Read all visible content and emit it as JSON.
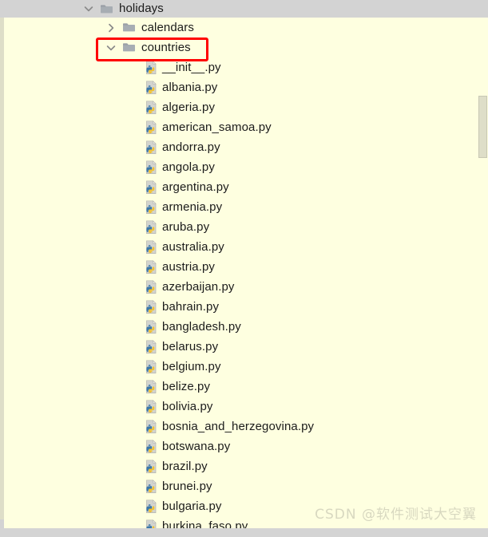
{
  "window": {
    "background_color": "#FEFFE0",
    "header_background_color": "#D3D3D3"
  },
  "tree": {
    "root": {
      "label": "holidays",
      "icon": "folder-icon",
      "chevron": "chevron-down-icon",
      "expanded": true,
      "selected": true,
      "indent": 1
    },
    "folders": [
      {
        "label": "calendars",
        "icon": "folder-icon",
        "chevron": "chevron-right-icon",
        "expanded": false,
        "highlighted": false,
        "indent": 2
      },
      {
        "label": "countries",
        "icon": "folder-icon",
        "chevron": "chevron-down-icon",
        "expanded": true,
        "highlighted": true,
        "indent": 2
      }
    ],
    "files": [
      {
        "label": "__init__.py",
        "icon": "python-file-icon"
      },
      {
        "label": "albania.py",
        "icon": "python-file-icon"
      },
      {
        "label": "algeria.py",
        "icon": "python-file-icon"
      },
      {
        "label": "american_samoa.py",
        "icon": "python-file-icon"
      },
      {
        "label": "andorra.py",
        "icon": "python-file-icon"
      },
      {
        "label": "angola.py",
        "icon": "python-file-icon"
      },
      {
        "label": "argentina.py",
        "icon": "python-file-icon"
      },
      {
        "label": "armenia.py",
        "icon": "python-file-icon"
      },
      {
        "label": "aruba.py",
        "icon": "python-file-icon"
      },
      {
        "label": "australia.py",
        "icon": "python-file-icon"
      },
      {
        "label": "austria.py",
        "icon": "python-file-icon"
      },
      {
        "label": "azerbaijan.py",
        "icon": "python-file-icon"
      },
      {
        "label": "bahrain.py",
        "icon": "python-file-icon"
      },
      {
        "label": "bangladesh.py",
        "icon": "python-file-icon"
      },
      {
        "label": "belarus.py",
        "icon": "python-file-icon"
      },
      {
        "label": "belgium.py",
        "icon": "python-file-icon"
      },
      {
        "label": "belize.py",
        "icon": "python-file-icon"
      },
      {
        "label": "bolivia.py",
        "icon": "python-file-icon"
      },
      {
        "label": "bosnia_and_herzegovina.py",
        "icon": "python-file-icon"
      },
      {
        "label": "botswana.py",
        "icon": "python-file-icon"
      },
      {
        "label": "brazil.py",
        "icon": "python-file-icon"
      },
      {
        "label": "brunei.py",
        "icon": "python-file-icon"
      },
      {
        "label": "bulgaria.py",
        "icon": "python-file-icon"
      },
      {
        "label": "burkina_faso.py",
        "icon": "python-file-icon"
      }
    ]
  },
  "annotation": {
    "highlight_target": "countries",
    "color": "#FF0000",
    "shape": "rectangle"
  },
  "scrollbar": {
    "orientation": "vertical",
    "thumb_color": "#DEDEC8"
  },
  "watermark": {
    "text": "CSDN @软件测试大空翼",
    "color": "#D8D8C0"
  }
}
